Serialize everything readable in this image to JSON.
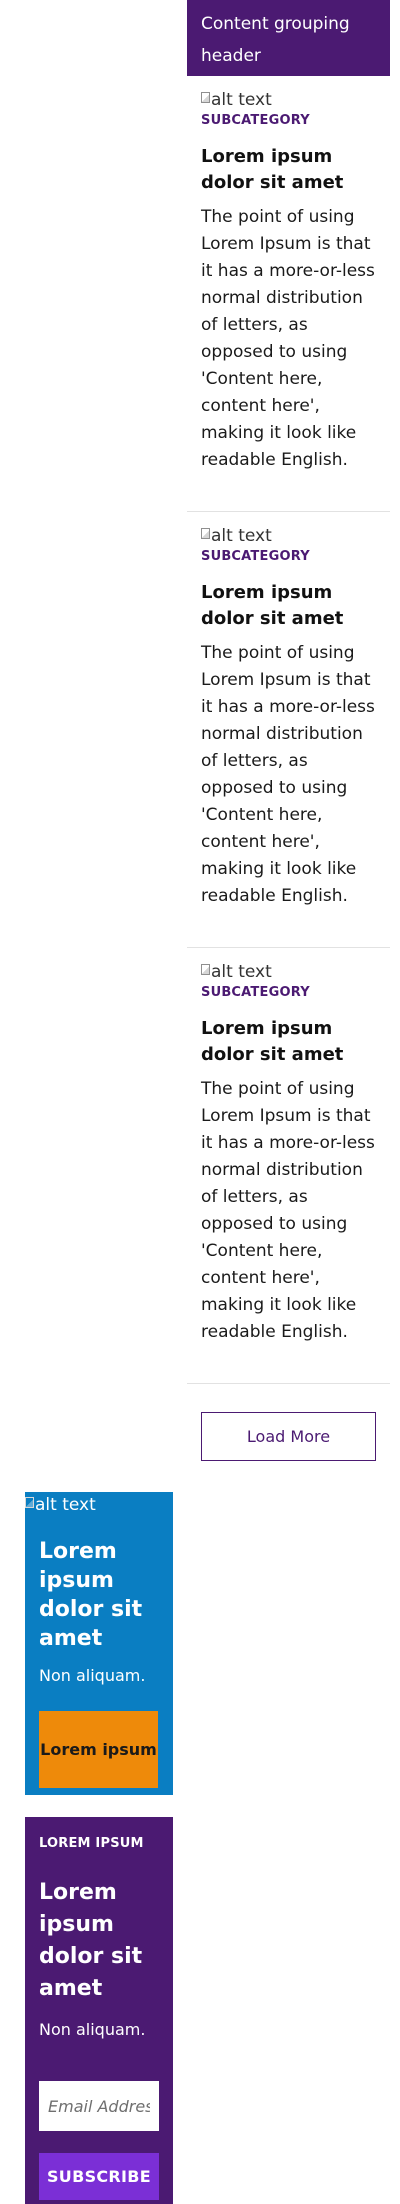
{
  "content_group": {
    "header": "Content grouping header",
    "cards": [
      {
        "image_alt": "alt text",
        "subcategory": "SUBCATEGORY",
        "title": "Lorem ipsum dolor sit amet",
        "body": "The point of using Lorem Ipsum is that it has a more-or-less normal distribution of letters, as opposed to using 'Content here, content here', making it look like readable English."
      },
      {
        "image_alt": "alt text",
        "subcategory": "SUBCATEGORY",
        "title": "Lorem ipsum dolor sit amet",
        "body": "The point of using Lorem Ipsum is that it has a more-or-less normal distribution of letters, as opposed to using 'Content here, content here', making it look like readable English."
      },
      {
        "image_alt": "alt text",
        "subcategory": "SUBCATEGORY",
        "title": "Lorem ipsum dolor sit amet",
        "body": "The point of using Lorem Ipsum is that it has a more-or-less normal distribution of letters, as opposed to using 'Content here, content here', making it look like readable English."
      }
    ],
    "load_more_label": "Load More"
  },
  "promo_blue": {
    "image_alt": "alt text",
    "title": "Lorem ipsum dolor sit amet",
    "text": "Non aliquam.",
    "button_label": "Lorem ipsum",
    "background": "#0a7ec2",
    "button_color": "#ee8a0a"
  },
  "promo_purple": {
    "eyebrow": "LOREM IPSUM",
    "title": "Lorem ipsum dolor sit amet",
    "text": "Non aliquam.",
    "email_placeholder": "Email Address",
    "subscribe_label": "SUBSCRIBE",
    "background": "#4b1a72",
    "button_color": "#7b2fd6"
  },
  "icons": {
    "broken_image": "broken-image-icon"
  },
  "colors": {
    "brand_purple": "#4b1a72",
    "divider": "#e2e2e2"
  }
}
